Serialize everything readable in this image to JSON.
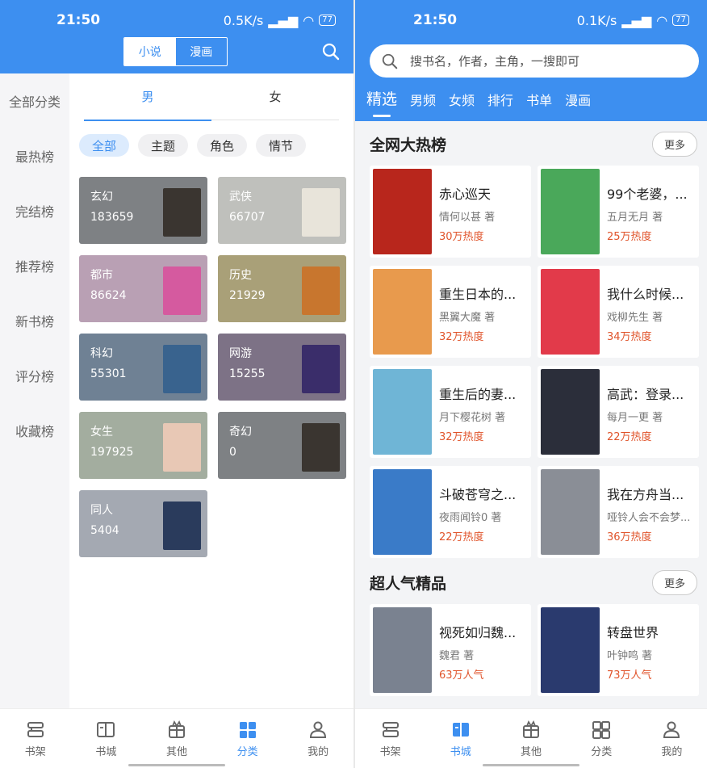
{
  "left": {
    "status": {
      "time": "21:50",
      "speed": "0.5K/s",
      "battery": "77"
    },
    "mode_tabs": [
      "小说",
      "漫画"
    ],
    "side_nav": [
      "全部分类",
      "最热榜",
      "完结榜",
      "推荐榜",
      "新书榜",
      "评分榜",
      "收藏榜"
    ],
    "gender_tabs": [
      "男",
      "女"
    ],
    "chips": [
      "全部",
      "主题",
      "角色",
      "情节"
    ],
    "categories": [
      {
        "name": "玄幻",
        "count": "183659",
        "color": "#7e8184",
        "cover": "#3a3530"
      },
      {
        "name": "武侠",
        "count": "66707",
        "color": "#bfc0bc",
        "cover": "#e8e4da"
      },
      {
        "name": "都市",
        "count": "86624",
        "color": "#b9a0b4",
        "cover": "#d55a9f"
      },
      {
        "name": "历史",
        "count": "21929",
        "color": "#a9a078",
        "cover": "#c8762e"
      },
      {
        "name": "科幻",
        "count": "55301",
        "color": "#6f8194",
        "cover": "#39638e"
      },
      {
        "name": "网游",
        "count": "15255",
        "color": "#7d7286",
        "cover": "#3a2d6a"
      },
      {
        "name": "女生",
        "count": "197925",
        "color": "#a3ad9f",
        "cover": "#e8c8b5"
      },
      {
        "name": "奇幻",
        "count": "0",
        "color": "#7e8184",
        "cover": "#3a3530"
      },
      {
        "name": "同人",
        "count": "5404",
        "color": "#a4a9b2",
        "cover": "#2a3b5c"
      }
    ],
    "bottom_nav": [
      "书架",
      "书城",
      "其他",
      "分类",
      "我的"
    ]
  },
  "right": {
    "status": {
      "time": "21:50",
      "speed": "0.1K/s",
      "battery": "77"
    },
    "search_placeholder": "搜书名，作者，主角，一搜即可",
    "top_tabs": [
      "精选",
      "男频",
      "女频",
      "排行",
      "书单",
      "漫画"
    ],
    "section1": {
      "title": "全网大热榜",
      "more": "更多"
    },
    "hot_books": [
      {
        "title": "赤心巡天",
        "author": "情何以甚 著",
        "hot": "30万热度",
        "cover": "#b8261c"
      },
      {
        "title": "99个老婆，...",
        "author": "五月无月 著",
        "hot": "25万热度",
        "cover": "#4aa85a"
      },
      {
        "title": "重生日本的...",
        "author": "黑翼大魔 著",
        "hot": "32万热度",
        "cover": "#e89a4d"
      },
      {
        "title": "我什么时候...",
        "author": "戏柳先生 著",
        "hot": "34万热度",
        "cover": "#e23a4a"
      },
      {
        "title": "重生后的妻...",
        "author": "月下樱花树 著",
        "hot": "32万热度",
        "cover": "#6fb5d6"
      },
      {
        "title": "高武：登录...",
        "author": "每月一更 著",
        "hot": "22万热度",
        "cover": "#2b2e3a"
      },
      {
        "title": "斗破苍穹之...",
        "author": "夜雨闻铃0 著",
        "hot": "22万热度",
        "cover": "#3a7bc8"
      },
      {
        "title": "我在方舟当...",
        "author": "哑铃人会不会梦...",
        "hot": "36万热度",
        "cover": "#8a8e96"
      }
    ],
    "section2": {
      "title": "超人气精品",
      "more": "更多"
    },
    "popular_books": [
      {
        "title": "视死如归魏...",
        "author": "魏君 著",
        "hot": "63万人气",
        "cover": "#7a8290"
      },
      {
        "title": "转盘世界",
        "author": "叶钟鸣 著",
        "hot": "73万人气",
        "cover": "#2a3a6e"
      }
    ],
    "bottom_nav": [
      "书架",
      "书城",
      "其他",
      "分类",
      "我的"
    ]
  }
}
